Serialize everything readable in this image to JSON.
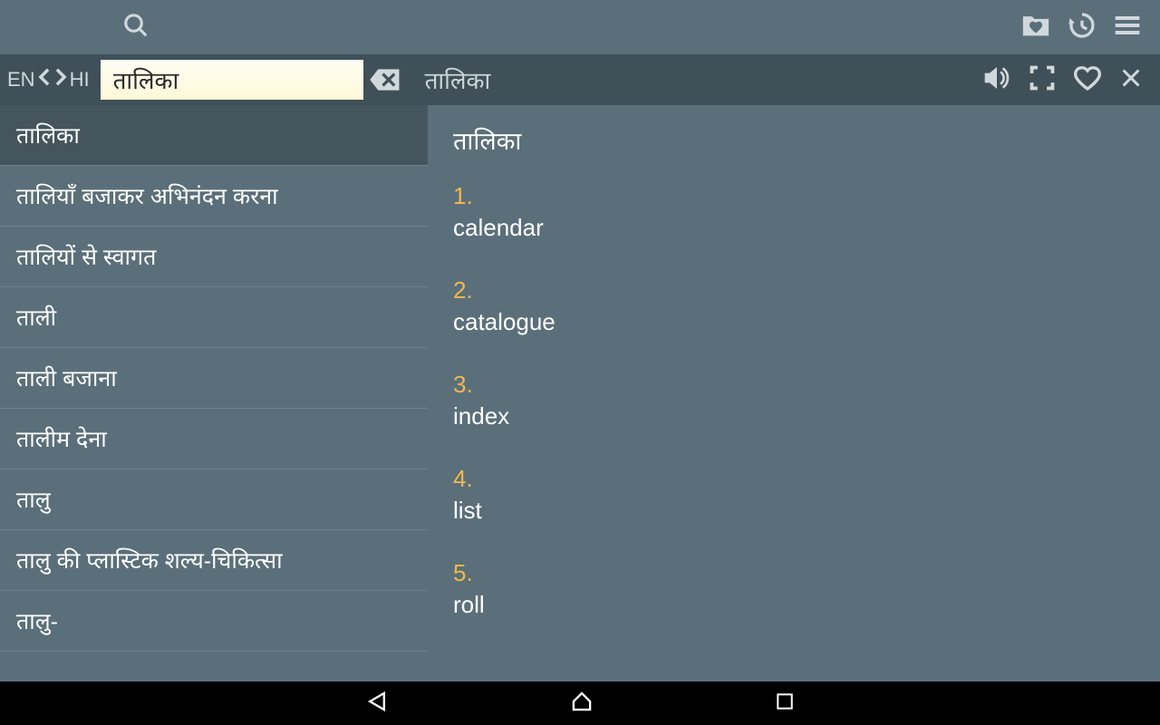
{
  "langSwitcher": {
    "from": "EN",
    "to": "HI"
  },
  "search": {
    "value": "तालिका"
  },
  "headerWord": "तालिका",
  "suggestions": [
    "तालिका",
    "तालियाँ बजाकर अभिनंदन करना",
    "तालियों से स्वागत",
    "ताली",
    "ताली बजाना",
    "तालीम देना",
    "तालु",
    "तालु की प्लास्टिक शल्य-चिकित्सा",
    "तालु-"
  ],
  "detail": {
    "title": "तालिका",
    "definitions": [
      {
        "num": "1.",
        "text": "calendar"
      },
      {
        "num": "2.",
        "text": "catalogue"
      },
      {
        "num": "3.",
        "text": "index"
      },
      {
        "num": "4.",
        "text": "list"
      },
      {
        "num": "5.",
        "text": "roll"
      }
    ]
  }
}
